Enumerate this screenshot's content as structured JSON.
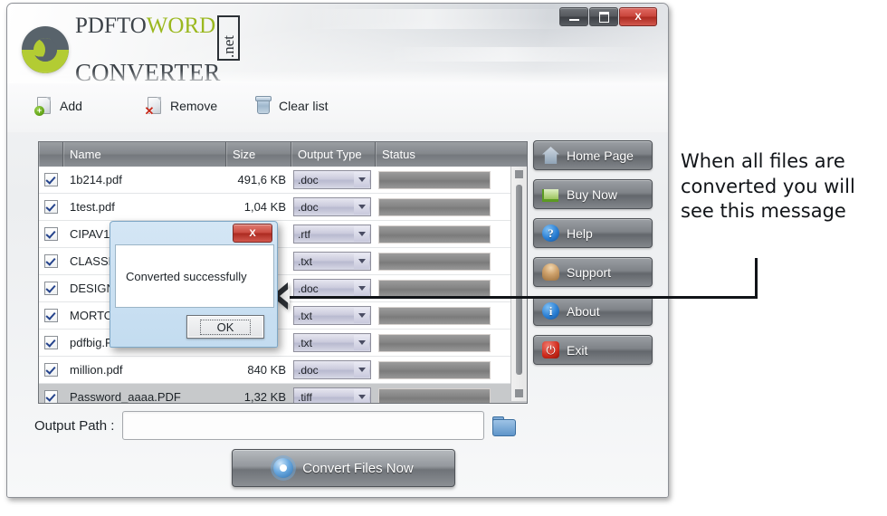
{
  "window": {
    "controls": [
      {
        "name": "minimize",
        "glyph": "—"
      },
      {
        "name": "maximize",
        "glyph": "❐"
      },
      {
        "name": "close",
        "glyph": "X"
      }
    ]
  },
  "logo": {
    "line1_part1": "PDF",
    "line1_part2": "TO",
    "line1_part3": "WORD",
    "line2": "CONVERTER",
    "net": ".net"
  },
  "toolbar": {
    "add_label": "Add",
    "remove_label": "Remove",
    "clear_label": "Clear list"
  },
  "table": {
    "headers": {
      "check": "",
      "name": "Name",
      "size": "Size",
      "type": "Output Type",
      "status": "Status"
    },
    "rows": [
      {
        "checked": true,
        "name": "1b214.pdf",
        "size": "491,6 KB",
        "type": ".doc",
        "status": "",
        "selected": false
      },
      {
        "checked": true,
        "name": "1test.pdf",
        "size": "1,04 KB",
        "type": ".doc",
        "status": "",
        "selected": false
      },
      {
        "checked": true,
        "name": "CIPAV1.pdf",
        "size": "",
        "type": ".rtf",
        "status": "",
        "selected": false
      },
      {
        "checked": true,
        "name": "CLASSNOTES.pdf",
        "size": "",
        "type": ".txt",
        "status": "",
        "selected": false
      },
      {
        "checked": true,
        "name": "DESIGN GUIDE.pdf",
        "size": "",
        "type": ".doc",
        "status": "",
        "selected": false
      },
      {
        "checked": true,
        "name": "MORTON.pdf",
        "size": "",
        "type": ".txt",
        "status": "",
        "selected": false
      },
      {
        "checked": true,
        "name": "pdfbig.PDF",
        "size": "",
        "type": ".txt",
        "status": "",
        "selected": false
      },
      {
        "checked": true,
        "name": "million.pdf",
        "size": "840 KB",
        "type": ".doc",
        "status": "",
        "selected": false
      },
      {
        "checked": true,
        "name": "Password_aaaa.PDF",
        "size": "1,32 KB",
        "type": ".tiff",
        "status": "",
        "selected": true
      }
    ]
  },
  "side_buttons": [
    {
      "label": "Home Page",
      "icon": "home-icon"
    },
    {
      "label": "Buy Now",
      "icon": "cart-icon"
    },
    {
      "label": "Help",
      "icon": "question-icon",
      "glyph": "?"
    },
    {
      "label": "Support",
      "icon": "headset-person-icon"
    },
    {
      "label": "About",
      "icon": "info-icon",
      "glyph": "i"
    },
    {
      "label": "Exit",
      "icon": "power-icon",
      "glyph": "⏻"
    }
  ],
  "output": {
    "label": "Output Path :",
    "value": "",
    "placeholder": "",
    "browse_icon": "folder-icon"
  },
  "convert": {
    "label": "Convert Files Now",
    "icon": "gear-icon"
  },
  "dialog": {
    "message": "Converted successfully",
    "ok_label": "OK",
    "close_glyph": "X"
  },
  "annotation": {
    "text": "When all files are converted you will see this message"
  },
  "colors": {
    "close_red": "#c9463c",
    "accent_green": "#9bb81f",
    "header_gray": "#83878c",
    "button_gray": "#7f8388"
  }
}
